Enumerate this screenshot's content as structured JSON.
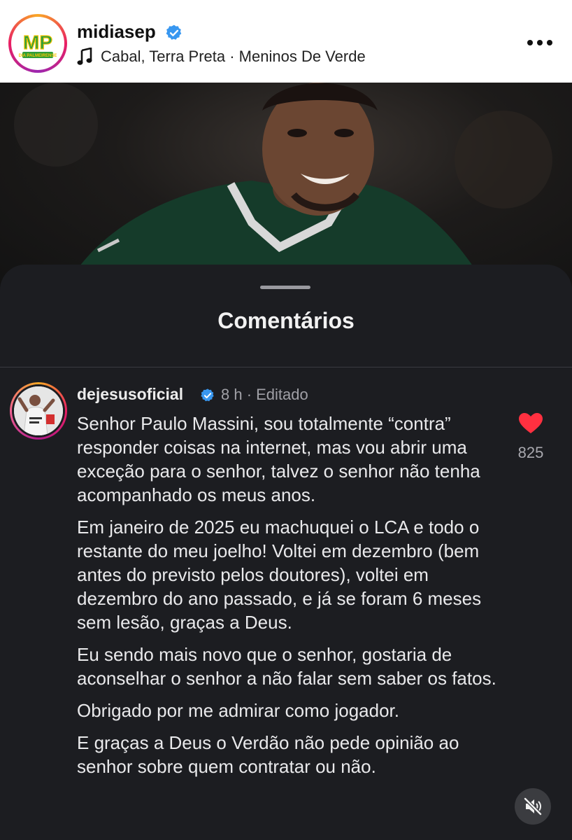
{
  "post": {
    "username": "midiasep",
    "audio": "Cabal, Terra Preta · Meninos De Verde",
    "avatar_logo_text": "MP",
    "avatar_logo_subtext": "DIA PALMEIRENSE"
  },
  "sheet": {
    "title": "Comentários"
  },
  "comment": {
    "username": "dejesusoficial",
    "meta": "8 h · Editado",
    "like_count": "825",
    "paragraphs": [
      "Senhor Paulo Massini, sou totalmente “contra” responder coisas na internet, mas vou abrir uma exceção para o senhor, talvez o senhor não tenha acompanhado os meus anos.",
      "Em janeiro de 2025 eu machuquei o LCA e todo o restante do meu joelho! Voltei em dezembro (bem antes do previsto pelos doutores), voltei em dezembro do ano passado, e já se foram 6 meses sem lesão, graças a Deus.",
      "Eu sendo mais novo que o senhor, gostaria de aconselhar o senhor a não falar sem saber os fatos.",
      "Obrigado por me admirar como jogador.",
      "E graças a Deus o Verdão não pede opinião ao senhor sobre quem contratar ou não."
    ]
  },
  "icons": {
    "verified": "verified-badge-icon",
    "music": "music-note-icon",
    "more": "more-options-icon",
    "heart": "heart-icon",
    "mute": "muted-speaker-icon"
  },
  "colors": {
    "verified_blue": "#3897f0",
    "heart_red": "#ff3040",
    "sheet_bg": "#1c1d21",
    "logo_green": "#2e9e3a"
  }
}
